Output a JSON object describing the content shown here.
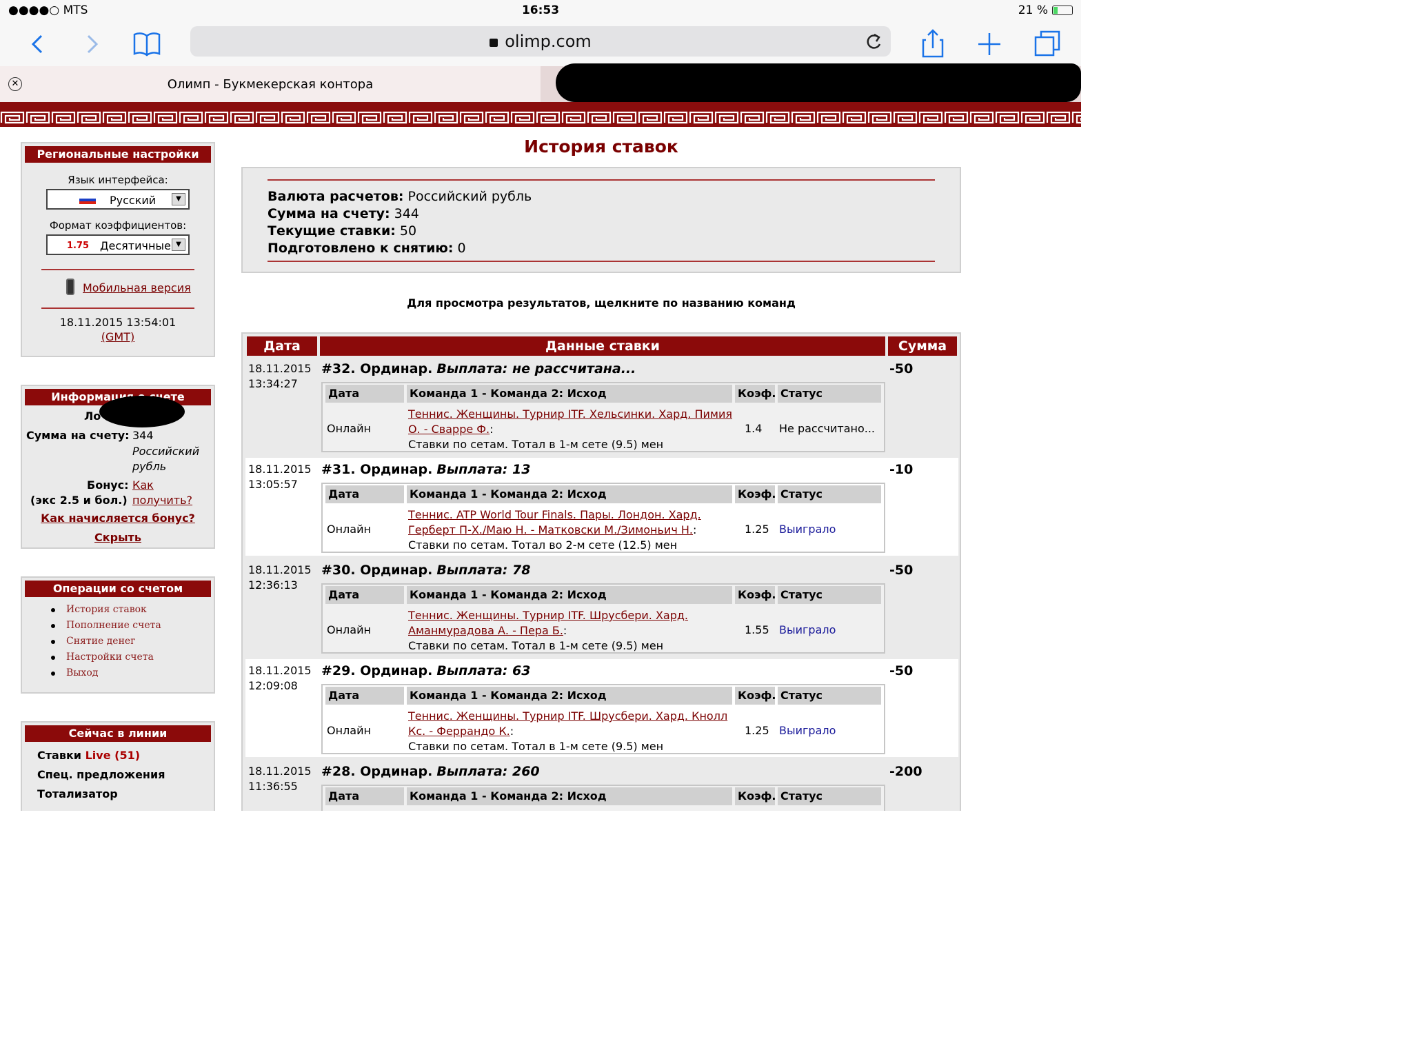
{
  "status_bar": {
    "carrier": "●●●●○ MTS",
    "time": "16:53",
    "battery": "21 %"
  },
  "browser": {
    "url": "olimp.com",
    "tab_title": "Олимп - Букмекерская контора"
  },
  "sidebar": {
    "regional": {
      "title": "Региональные настройки",
      "lang_label": "Язык интерфейса:",
      "lang_value": "Русский",
      "odds_label": "Формат коэффициентов:",
      "odds_sample": "1.75",
      "odds_value": "Десятичные",
      "mobile_link": "Мобильная версия",
      "datetime": "18.11.2015 13:54:01",
      "tz": "(GMT)"
    },
    "account_info": {
      "title": "Информация о счете",
      "login_label": "Ло",
      "balance_label": "Сумма на счету:",
      "balance_value": "344",
      "balance_currency": "Российский рубль",
      "bonus_label": "Бонус:",
      "bonus_cond": "(экс 2.5 и бол.)",
      "bonus_link1": "Как",
      "bonus_link2": "получить?",
      "bonus_how": "Как начисляется бонус?",
      "hide": "Скрыть"
    },
    "operations": {
      "title": "Операции со счетом",
      "items": [
        "История ставок",
        "Пополнение счета",
        "Снятие денег",
        "Настройки счета",
        "Выход"
      ]
    },
    "line": {
      "title": "Сейчас в линии",
      "live_label": "Ставки",
      "live_link": "Live (51)",
      "special": "Спец. предложения",
      "toto": "Тотализатор"
    }
  },
  "main": {
    "title": "История ставок",
    "summary": {
      "currency_label": "Валюта расчетов:",
      "currency_value": "Российский рубль",
      "balance_label": "Сумма на счету:",
      "balance_value": "344",
      "current_label": "Текущие ставки:",
      "current_value": "50",
      "withdraw_label": "Подготовлено к снятию:",
      "withdraw_value": "0"
    },
    "hint": "Для просмотра результатов, щелкните по названию команд",
    "table_headers": {
      "date": "Дата",
      "data": "Данные ставки",
      "sum": "Сумма"
    },
    "inner_headers": {
      "date": "Дата",
      "teams": "Команда 1 - Команда 2: Исход",
      "coef": "Коэф.",
      "status": "Статус"
    },
    "bets": [
      {
        "date": "18.11.2015",
        "time": "13:34:27",
        "num": "#32. Ординар.",
        "payout": "Выплата: не рассчитана...",
        "sum": "-50",
        "mode": "Онлайн",
        "event1": "Теннис. Женщины. Турнир ITF. Хельсинки. Хард. Пимия",
        "event2": "О. - Сварре Ф.",
        "market": "Ставки по сетам. Тотал в 1-м сете (9.5) мен",
        "coef": "1.4",
        "status": "Не рассчитано..."
      },
      {
        "date": "18.11.2015",
        "time": "13:05:57",
        "num": "#31. Ординар.",
        "payout": "Выплата: 13",
        "sum": "-10",
        "mode": "Онлайн",
        "event1": "Теннис. ATP World Tour Finals. Пары. Лондон. Хард.",
        "event2": "Герберт П-Х./Маю Н. - Матковски М./Зимоньич Н.",
        "market": "Ставки по сетам. Тотал во 2-м сете (12.5) мен",
        "coef": "1.25",
        "status": "Выиграло"
      },
      {
        "date": "18.11.2015",
        "time": "12:36:13",
        "num": "#30. Ординар.",
        "payout": "Выплата: 78",
        "sum": "-50",
        "mode": "Онлайн",
        "event1": "Теннис. Женщины. Турнир ITF. Шрусбери. Хард.",
        "event2": "Аманмурадова А. - Пера Б.",
        "market": "Ставки по сетам. Тотал в 1-м сете (9.5) мен",
        "coef": "1.55",
        "status": "Выиграло"
      },
      {
        "date": "18.11.2015",
        "time": "12:09:08",
        "num": "#29. Ординар.",
        "payout": "Выплата: 63",
        "sum": "-50",
        "mode": "Онлайн",
        "event1": "Теннис. Женщины. Турнир ITF. Шрусбери. Хард. Кнолл",
        "event2": "Кс. - Феррандо К.",
        "market": "Ставки по сетам. Тотал в 1-м сете (9.5) мен",
        "coef": "1.25",
        "status": "Выиграло"
      },
      {
        "date": "18.11.2015",
        "time": "11:36:55",
        "num": "#28. Ординар.",
        "payout": "Выплата: 260",
        "sum": "-200",
        "mode": "",
        "event1": "",
        "event2": "",
        "market": "",
        "coef": "",
        "status": ""
      }
    ]
  },
  "colors": {
    "brand": "#8b0a0a",
    "link": "#7a0000",
    "win": "#1a1a9a",
    "ios_blue": "#1a73e8"
  }
}
